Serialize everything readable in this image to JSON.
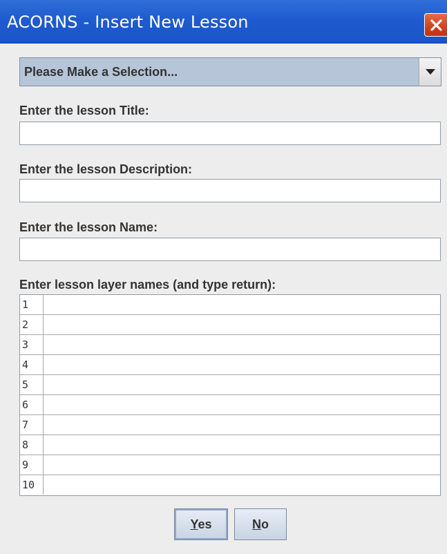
{
  "window": {
    "title": "ACORNS - Insert New Lesson"
  },
  "selection": {
    "value": "Please Make a Selection..."
  },
  "title_field": {
    "label": "Enter the lesson Title:",
    "value": ""
  },
  "description_field": {
    "label": "Enter the lesson Description:",
    "value": ""
  },
  "name_field": {
    "label": "Enter the lesson Name:",
    "value": ""
  },
  "layers": {
    "label": "Enter lesson layer names (and type return):",
    "rows": [
      {
        "num": "1",
        "value": ""
      },
      {
        "num": "2",
        "value": ""
      },
      {
        "num": "3",
        "value": ""
      },
      {
        "num": "4",
        "value": ""
      },
      {
        "num": "5",
        "value": ""
      },
      {
        "num": "6",
        "value": ""
      },
      {
        "num": "7",
        "value": ""
      },
      {
        "num": "8",
        "value": ""
      },
      {
        "num": "9",
        "value": ""
      },
      {
        "num": "10",
        "value": ""
      }
    ]
  },
  "buttons": {
    "yes_mnemonic": "Y",
    "yes_rest": "es",
    "no_mnemonic": "N",
    "no_rest": "o"
  },
  "icons": {
    "close": "close-icon",
    "dropdown": "chevron-down-icon"
  },
  "colors": {
    "titlebar": "#1f5bd0",
    "close_button": "#d2401f",
    "combo_background": "#b6c5d8"
  }
}
